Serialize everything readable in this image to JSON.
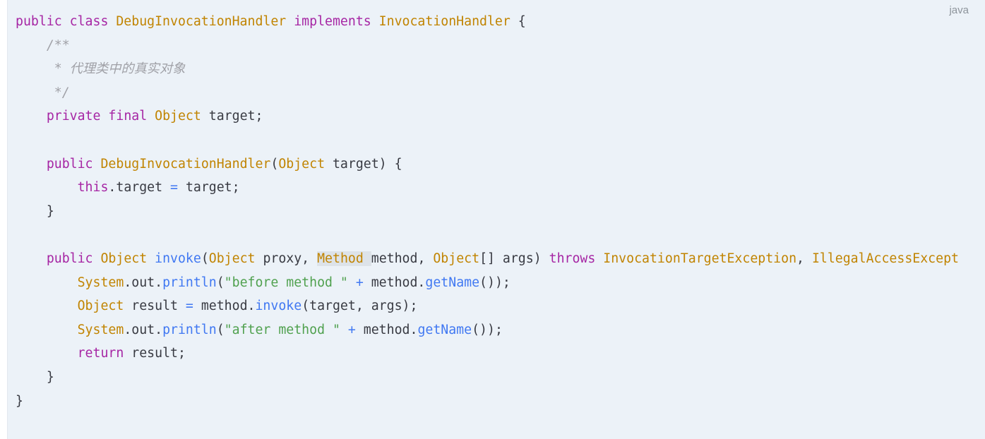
{
  "code_block": {
    "language": "java",
    "lines": {
      "l1": [
        "public",
        "class",
        "DebugInvocationHandler",
        "implements",
        "InvocationHandler",
        "{"
      ],
      "l2": [
        "/**"
      ],
      "l3": [
        "* 代理类中的真实对象"
      ],
      "l4": [
        "*/"
      ],
      "l5": [
        "private",
        "final",
        "Object",
        "target;"
      ],
      "l7": [
        "public",
        "DebugInvocationHandler",
        "(",
        "Object",
        "target) {"
      ],
      "l8": [
        "this",
        ".target",
        "=",
        "target;"
      ],
      "l9": [
        "}"
      ],
      "l11": [
        "public",
        "Object",
        "invoke",
        "(",
        "Object",
        "proxy,",
        "Method",
        "method,",
        "Object",
        "[] args)",
        "throws",
        "InvocationTargetException",
        ",",
        "IllegalAccessExcept"
      ],
      "l12": [
        "System",
        ".out.",
        "println",
        "(",
        "\"before method \"",
        "+",
        "method.",
        "getName",
        "());"
      ],
      "l13": [
        "Object",
        "result",
        "=",
        "method.",
        "invoke",
        "(target, args);"
      ],
      "l14": [
        "System",
        ".out.",
        "println",
        "(",
        "\"after method \"",
        "+",
        "method.",
        "getName",
        "());"
      ],
      "l15": [
        "return",
        "result;"
      ],
      "l16": [
        "}"
      ],
      "l17": [
        "}"
      ]
    }
  }
}
